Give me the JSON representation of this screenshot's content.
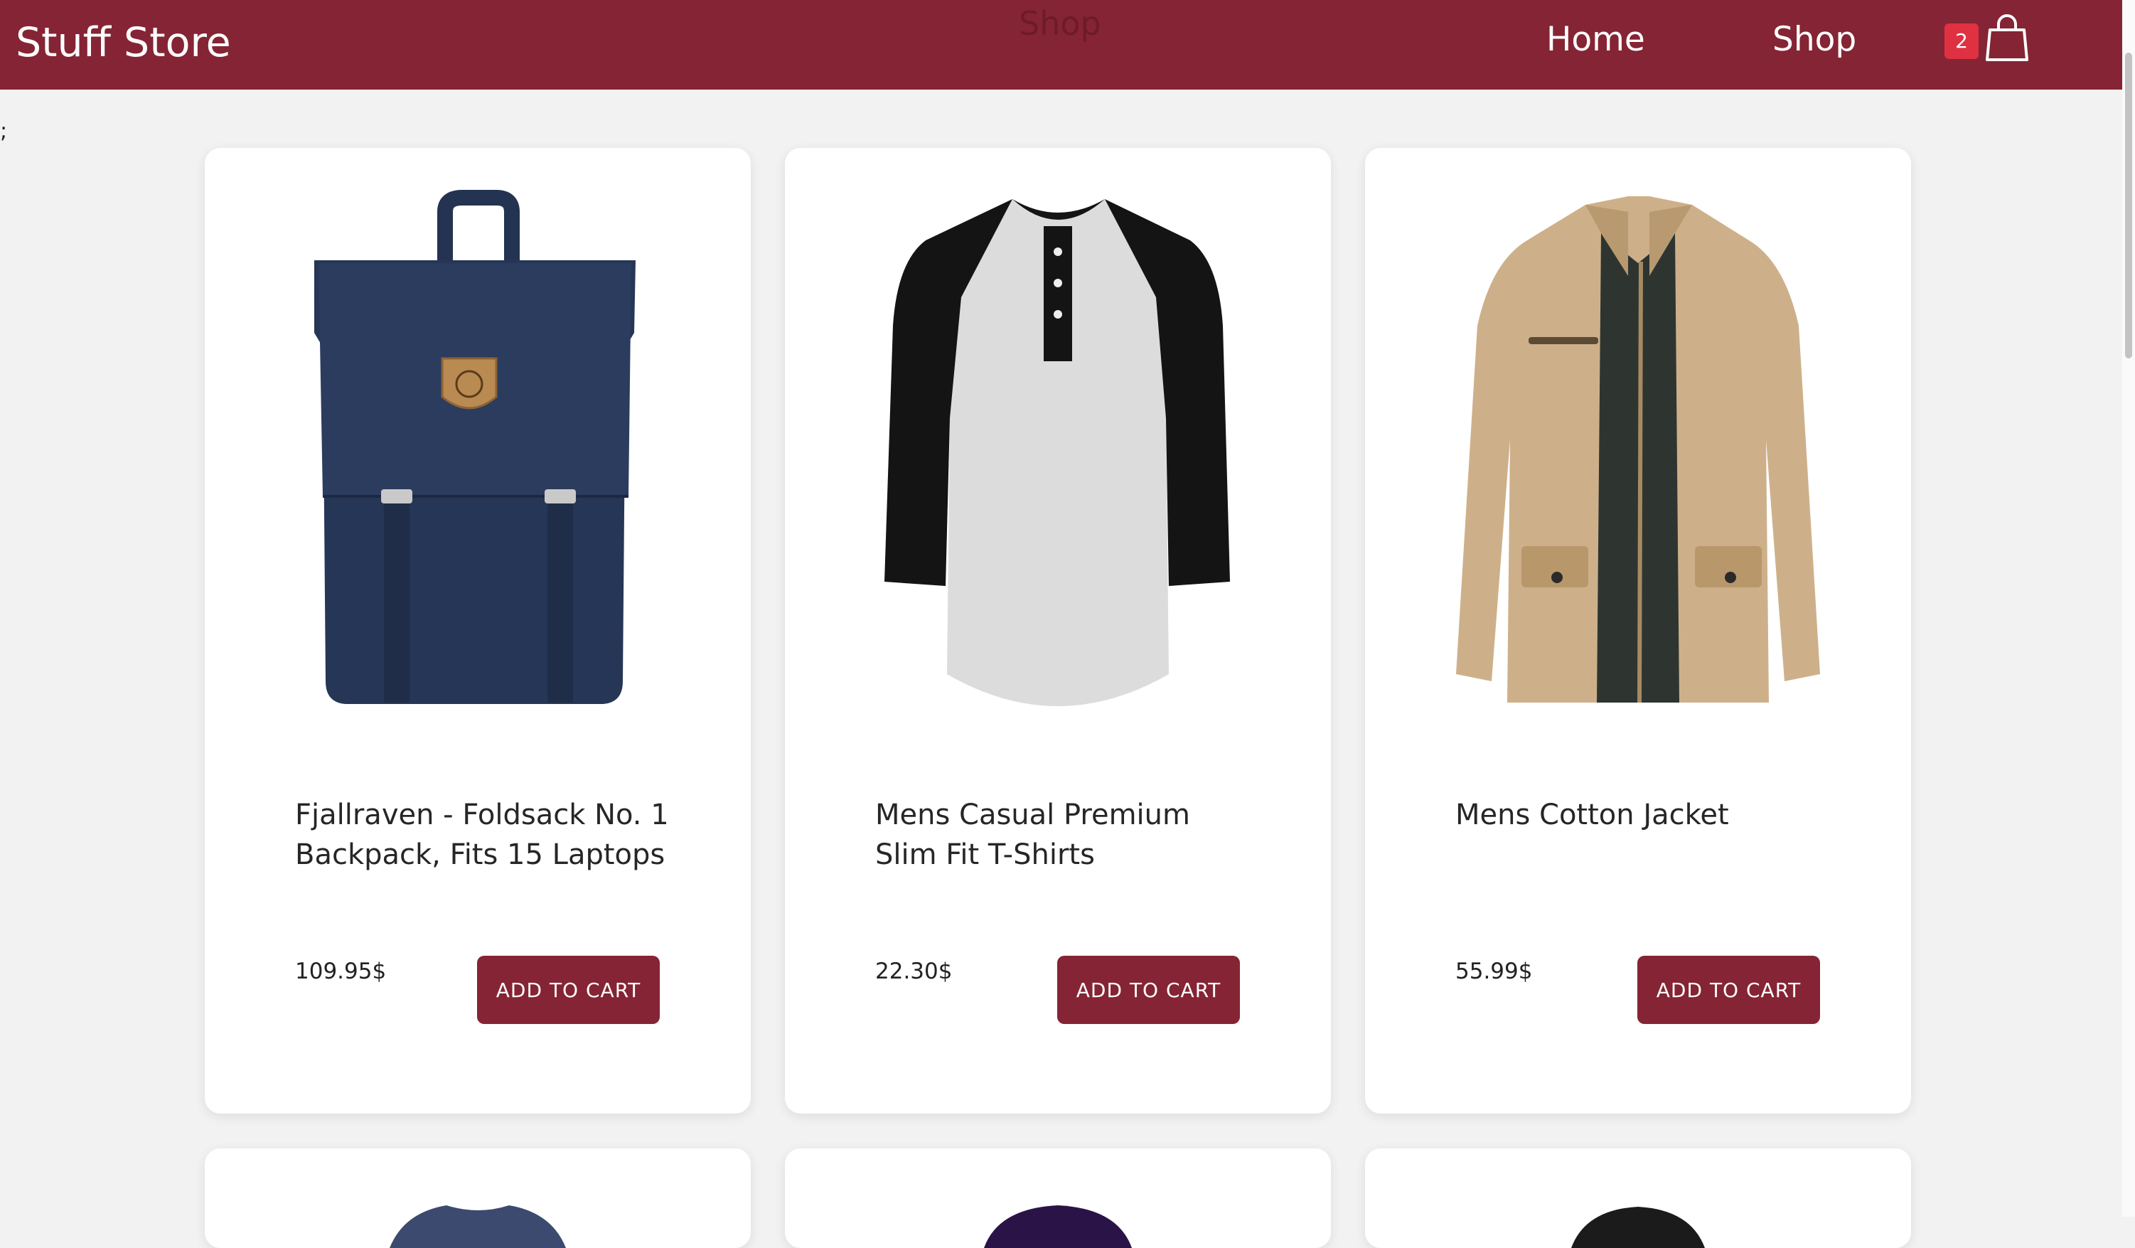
{
  "navbar": {
    "brand": "Stuff Store",
    "page_title": "Shop",
    "links": [
      "Home",
      "Shop"
    ],
    "cart_count": "2",
    "cart_icon": "shopping-bag-icon",
    "color": "#852434",
    "badge_color": "#df3141"
  },
  "stray_text": ";",
  "products": [
    {
      "title": "Fjallraven - Foldsack No. 1 Backpack, Fits 15 Laptops",
      "price": "109.95$",
      "button": "ADD TO CART",
      "image": "navy-backpack"
    },
    {
      "title": "Mens Casual Premium Slim Fit T-Shirts",
      "price": "22.30$",
      "button": "ADD TO CART",
      "image": "raglan-henley-tshirt"
    },
    {
      "title": "Mens Cotton Jacket",
      "price": "55.99$",
      "button": "ADD TO CART",
      "image": "khaki-cotton-jacket"
    }
  ],
  "next_row_images": [
    "blue-shirt",
    "purple-garment",
    "black-garment"
  ]
}
